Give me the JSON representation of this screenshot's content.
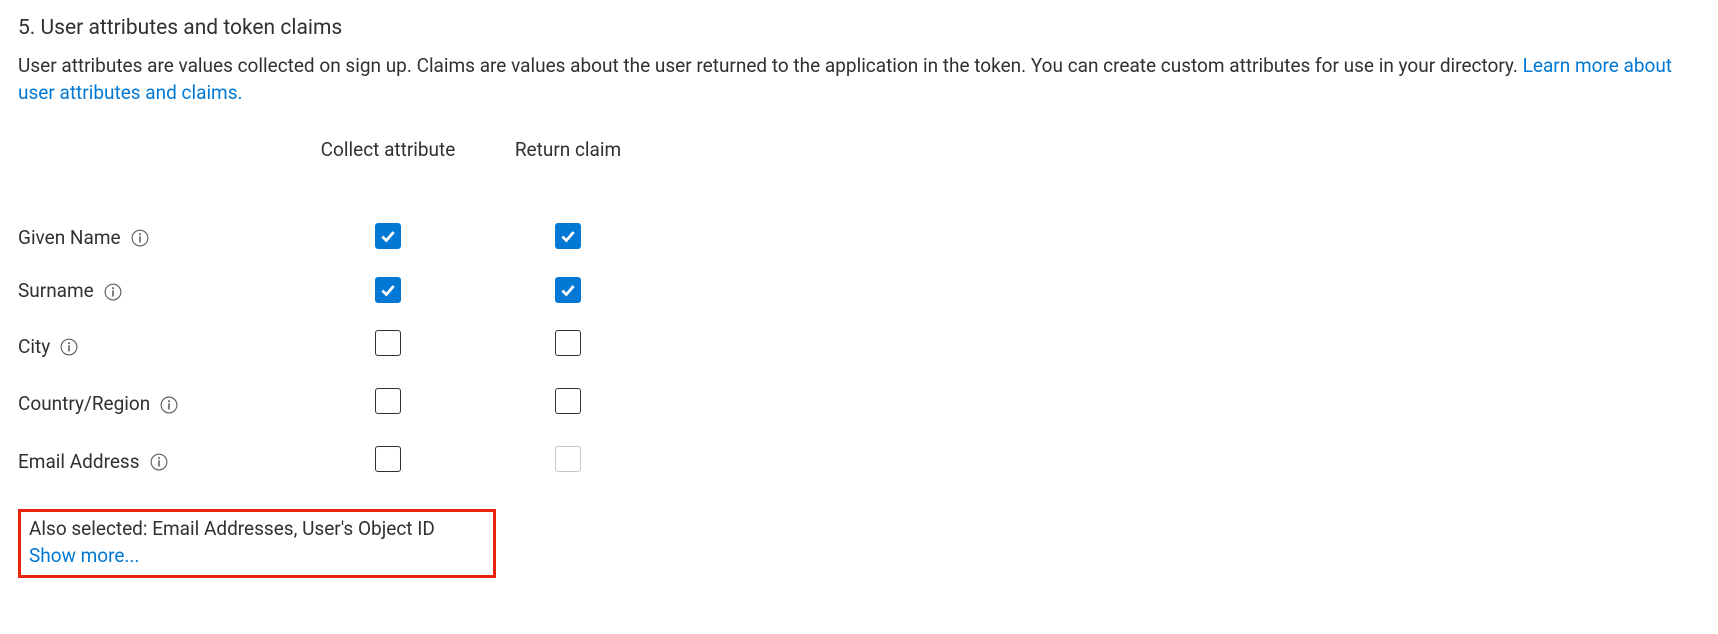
{
  "section": {
    "title": "5. User attributes and token claims",
    "description": "User attributes are values collected on sign up. Claims are values about the user returned to the application in the token. You can create custom attributes for use in your directory. ",
    "learn_more": "Learn more about user attributes and claims."
  },
  "columns": {
    "name": "",
    "collect": "Collect attribute",
    "return": "Return claim"
  },
  "rows": [
    {
      "label": "Given Name",
      "collect": true,
      "return": true,
      "return_disabled": false
    },
    {
      "label": "Surname",
      "collect": true,
      "return": true,
      "return_disabled": false
    },
    {
      "label": "City",
      "collect": false,
      "return": false,
      "return_disabled": false
    },
    {
      "label": "Country/Region",
      "collect": false,
      "return": false,
      "return_disabled": false
    },
    {
      "label": "Email Address",
      "collect": false,
      "return": false,
      "return_disabled": true
    }
  ],
  "footer": {
    "also_selected": "Also selected: Email Addresses, User's Object ID",
    "show_more": "Show more..."
  }
}
